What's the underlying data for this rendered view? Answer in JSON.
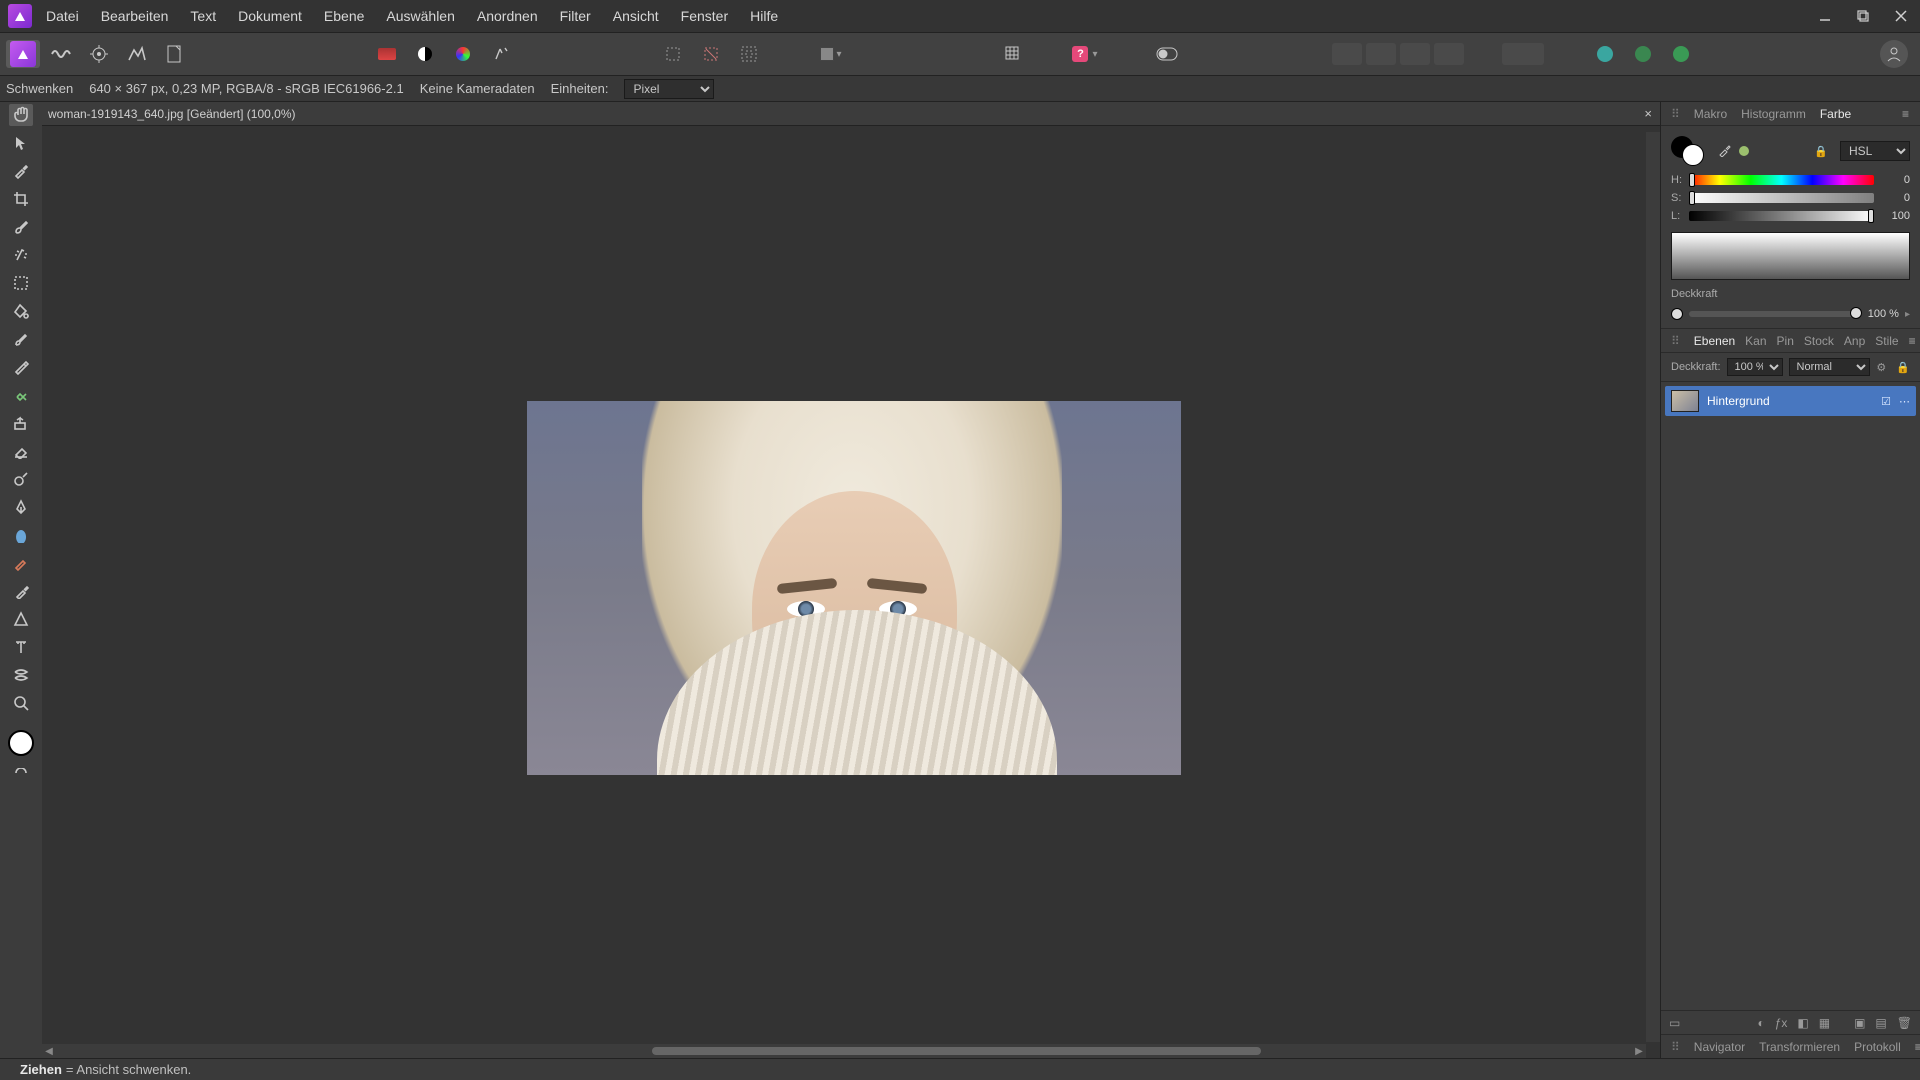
{
  "menu": [
    "Datei",
    "Bearbeiten",
    "Text",
    "Dokument",
    "Ebene",
    "Auswählen",
    "Anordnen",
    "Filter",
    "Ansicht",
    "Fenster",
    "Hilfe"
  ],
  "info": {
    "tool": "Schwenken",
    "dims": "640 × 367 px, 0,23 MP, RGBA/8 - sRGB IEC61966-2.1",
    "camera": "Keine Kameradaten",
    "units_label": "Einheiten:",
    "units_value": "Pixel"
  },
  "doc_tab": "woman-1919143_640.jpg [Geändert] (100,0%)",
  "right_tabs_top": [
    "Makro",
    "Histogramm",
    "Farbe"
  ],
  "right_tabs_top_sel": 2,
  "color": {
    "mode": "HSL",
    "h": {
      "label": "H:",
      "value": 0
    },
    "s": {
      "label": "S:",
      "value": 0
    },
    "l": {
      "label": "L:",
      "value": 100
    },
    "opacity_label": "Deckkraft",
    "opacity_value": "100 %"
  },
  "layer_tabs": [
    "Ebenen",
    "Kan",
    "Pin",
    "Stock",
    "Anp",
    "Stile"
  ],
  "layer_tabs_sel": 0,
  "layer_opts": {
    "opacity_label": "Deckkraft:",
    "opacity_value": "100 %",
    "blend_value": "Normal"
  },
  "layer_item_name": "Hintergrund",
  "nav_tabs": [
    "Navigator",
    "Transformieren",
    "Protokoll"
  ],
  "status": {
    "bold": "Ziehen",
    "rest": " = Ansicht schwenken."
  }
}
